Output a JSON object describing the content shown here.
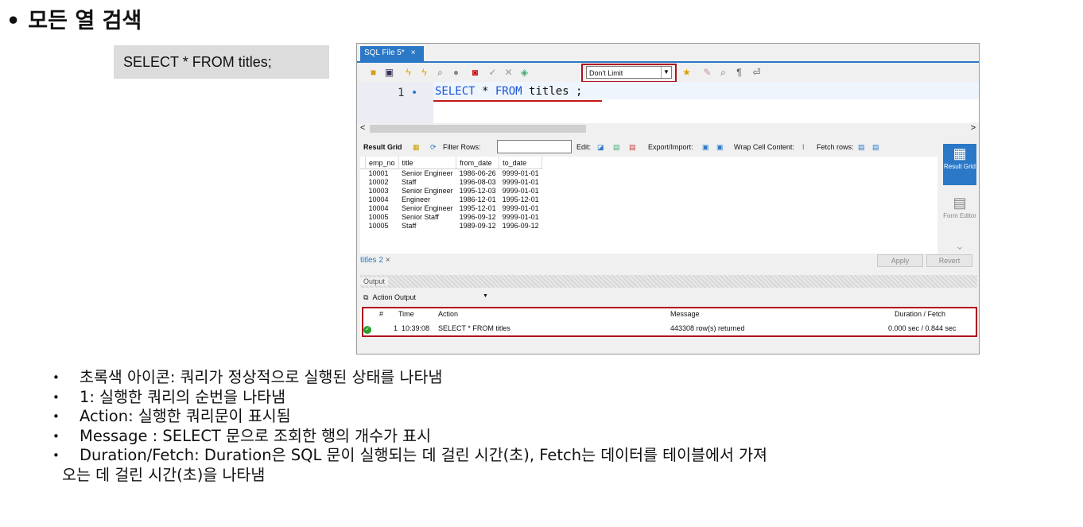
{
  "heading": {
    "bullet": "•",
    "text": "모든 열 검색"
  },
  "sql_example": "SELECT * FROM titles;",
  "workbench": {
    "tab_label": "SQL File 5*",
    "tab_close": "×",
    "limit_select": "Don't Limit",
    "editor": {
      "line_number": "1",
      "line_marker": "•",
      "code_keyword_1": "SELECT",
      "code_middle": " * ",
      "code_keyword_2": "FROM",
      "code_rest": " titles ;"
    },
    "scroll_left": "<",
    "scroll_right": ">",
    "result_toolbar": {
      "result_grid": "Result Grid",
      "filter_rows": "Filter Rows:",
      "edit": "Edit:",
      "export_import": "Export/Import:",
      "wrap_cell": "Wrap Cell Content:",
      "fetch_rows": "Fetch rows:"
    },
    "grid": {
      "columns": [
        "emp_no",
        "title",
        "from_date",
        "to_date"
      ],
      "rows": [
        [
          "10001",
          "Senior Engineer",
          "1986-06-26",
          "9999-01-01"
        ],
        [
          "10002",
          "Staff",
          "1996-08-03",
          "9999-01-01"
        ],
        [
          "10003",
          "Senior Engineer",
          "1995-12-03",
          "9999-01-01"
        ],
        [
          "10004",
          "Engineer",
          "1986-12-01",
          "1995-12-01"
        ],
        [
          "10004",
          "Senior Engineer",
          "1995-12-01",
          "9999-01-01"
        ],
        [
          "10005",
          "Senior Staff",
          "1996-09-12",
          "9999-01-01"
        ],
        [
          "10005",
          "Staff",
          "1989-09-12",
          "1996-09-12"
        ]
      ]
    },
    "side_panel": {
      "result_grid": "Result Grid",
      "form_editor": "Form Editor"
    },
    "result_tab": "titles 2",
    "apply": "Apply",
    "revert": "Revert",
    "output_label": "Output",
    "action_output": "Action Output",
    "output_table": {
      "headers": {
        "num": "#",
        "time": "Time",
        "action": "Action",
        "message": "Message",
        "duration": "Duration / Fetch"
      },
      "row": {
        "num": "1",
        "time": "10:39:08",
        "action": "SELECT * FROM titles",
        "message": "443308 row(s) returned",
        "duration": "0.000 sec / 0.844 sec"
      }
    }
  },
  "bullets": [
    "초록색 아이콘: 쿼리가 정상적으로 실행된 상태를 나타냄",
    "1: 실행한 쿼리의 순번을 나타냄",
    "Action: 실행한 쿼리문이 표시됨",
    "Message : SELECT 문으로 조회한 행의 개수가 표시",
    "Duration/Fetch: Duration은 SQL 문이 실행되는 데 걸린 시간(초), Fetch는 데이터를 테이블에서 가져"
  ],
  "bullet_continuation": "오는 데 걸린 시간(초)을 나타냄",
  "colors": {
    "accent_blue": "#2b78c6",
    "highlight_red": "#b00f1e",
    "ok_green": "#26a22e"
  }
}
